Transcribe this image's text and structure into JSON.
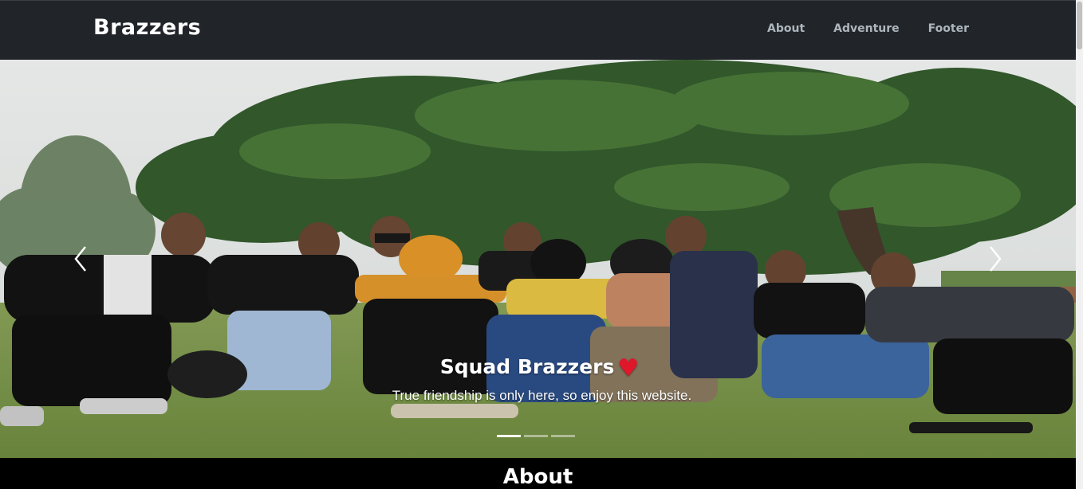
{
  "navbar": {
    "brand": "Brazzers",
    "links": [
      {
        "label": "About"
      },
      {
        "label": "Adventure"
      },
      {
        "label": "Footer"
      }
    ]
  },
  "carousel": {
    "caption_title": "Squad Brazzers",
    "caption_heart": "♥",
    "caption_text": "True friendship is only here, so enjoy this website.",
    "slide_count": 3,
    "active_slide": 1,
    "prev_icon": "chevron-left-icon",
    "next_icon": "chevron-right-icon"
  },
  "about": {
    "heading": "About"
  },
  "colors": {
    "navbar_bg": "#212529",
    "nav_link": "#adb5bd",
    "heart": "#e0162b",
    "page_bg": "#000000"
  }
}
